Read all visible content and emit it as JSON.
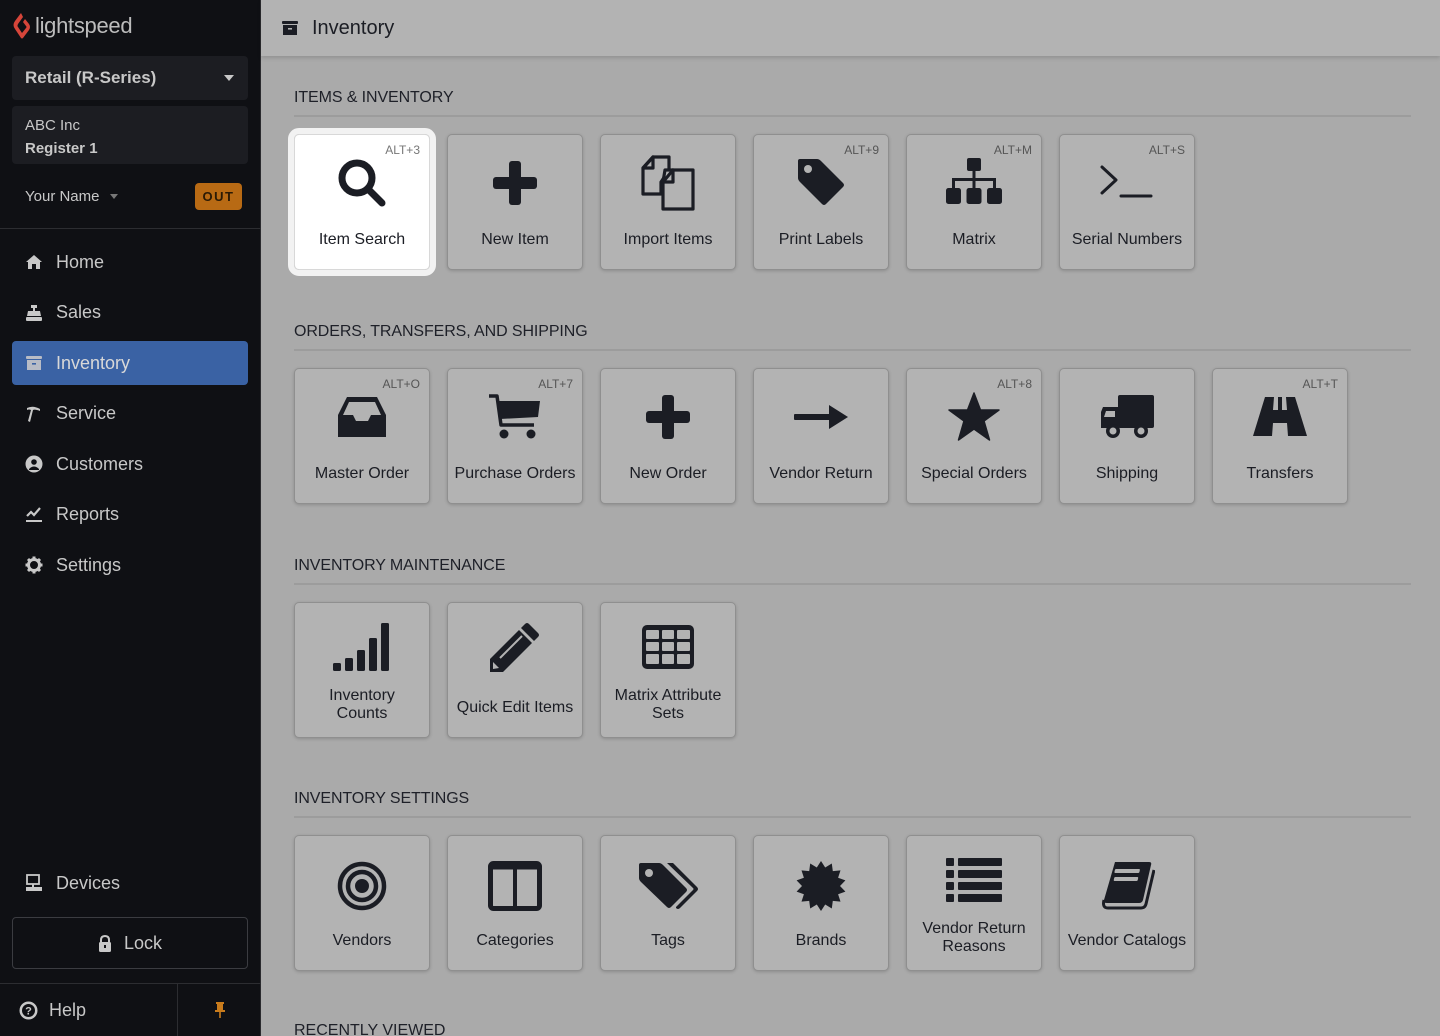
{
  "app": {
    "brand": "lightspeed",
    "accent_color": "#3a62a4",
    "logo_color": "#d6453a"
  },
  "sidebar": {
    "store_selector": "Retail (R-Series)",
    "company": "ABC Inc",
    "register": "Register 1",
    "user_name": "Your Name",
    "clock_status": "OUT",
    "nav": [
      {
        "label": "Home",
        "icon": "home-icon",
        "active": false
      },
      {
        "label": "Sales",
        "icon": "register-icon",
        "active": false
      },
      {
        "label": "Inventory",
        "icon": "archive-icon",
        "active": true
      },
      {
        "label": "Service",
        "icon": "hammer-icon",
        "active": false
      },
      {
        "label": "Customers",
        "icon": "user-circle-icon",
        "active": false
      },
      {
        "label": "Reports",
        "icon": "chart-line-icon",
        "active": false
      },
      {
        "label": "Settings",
        "icon": "gear-icon",
        "active": false
      }
    ],
    "devices": "Devices",
    "lock": "Lock",
    "help": "Help"
  },
  "header": {
    "title": "Inventory"
  },
  "sections": [
    {
      "title": "ITEMS & INVENTORY",
      "tiles": [
        {
          "label": "Item Search",
          "shortcut": "ALT+3",
          "icon": "search-icon",
          "highlighted": true
        },
        {
          "label": "New Item",
          "shortcut": "",
          "icon": "plus-icon"
        },
        {
          "label": "Import Items",
          "shortcut": "",
          "icon": "copy-files-icon"
        },
        {
          "label": "Print Labels",
          "shortcut": "ALT+9",
          "icon": "tag-icon"
        },
        {
          "label": "Matrix",
          "shortcut": "ALT+M",
          "icon": "sitemap-icon"
        },
        {
          "label": "Serial Numbers",
          "shortcut": "ALT+S",
          "icon": "terminal-icon"
        }
      ]
    },
    {
      "title": "ORDERS, TRANSFERS, AND SHIPPING",
      "tiles": [
        {
          "label": "Master Order",
          "shortcut": "ALT+O",
          "icon": "inbox-icon"
        },
        {
          "label": "Purchase Orders",
          "shortcut": "ALT+7",
          "icon": "cart-icon"
        },
        {
          "label": "New Order",
          "shortcut": "",
          "icon": "plus-icon"
        },
        {
          "label": "Vendor Return",
          "shortcut": "",
          "icon": "arrow-right-icon"
        },
        {
          "label": "Special Orders",
          "shortcut": "ALT+8",
          "icon": "star-icon"
        },
        {
          "label": "Shipping",
          "shortcut": "",
          "icon": "truck-icon"
        },
        {
          "label": "Transfers",
          "shortcut": "ALT+T",
          "icon": "road-icon"
        }
      ]
    },
    {
      "title": "INVENTORY MAINTENANCE",
      "tiles": [
        {
          "label": "Inventory Counts",
          "shortcut": "",
          "icon": "signal-bars-icon"
        },
        {
          "label": "Quick Edit Items",
          "shortcut": "",
          "icon": "pencil-icon"
        },
        {
          "label": "Matrix Attribute Sets",
          "shortcut": "",
          "icon": "grid-icon"
        }
      ]
    },
    {
      "title": "INVENTORY SETTINGS",
      "tiles": [
        {
          "label": "Vendors",
          "shortcut": "",
          "icon": "target-icon"
        },
        {
          "label": "Categories",
          "shortcut": "",
          "icon": "columns-icon"
        },
        {
          "label": "Tags",
          "shortcut": "",
          "icon": "tags-icon"
        },
        {
          "label": "Brands",
          "shortcut": "",
          "icon": "certificate-icon"
        },
        {
          "label": "Vendor Return Reasons",
          "shortcut": "",
          "icon": "list-icon"
        },
        {
          "label": "Vendor Catalogs",
          "shortcut": "",
          "icon": "book-icon"
        }
      ]
    }
  ],
  "recently_viewed_title": "RECENTLY VIEWED"
}
